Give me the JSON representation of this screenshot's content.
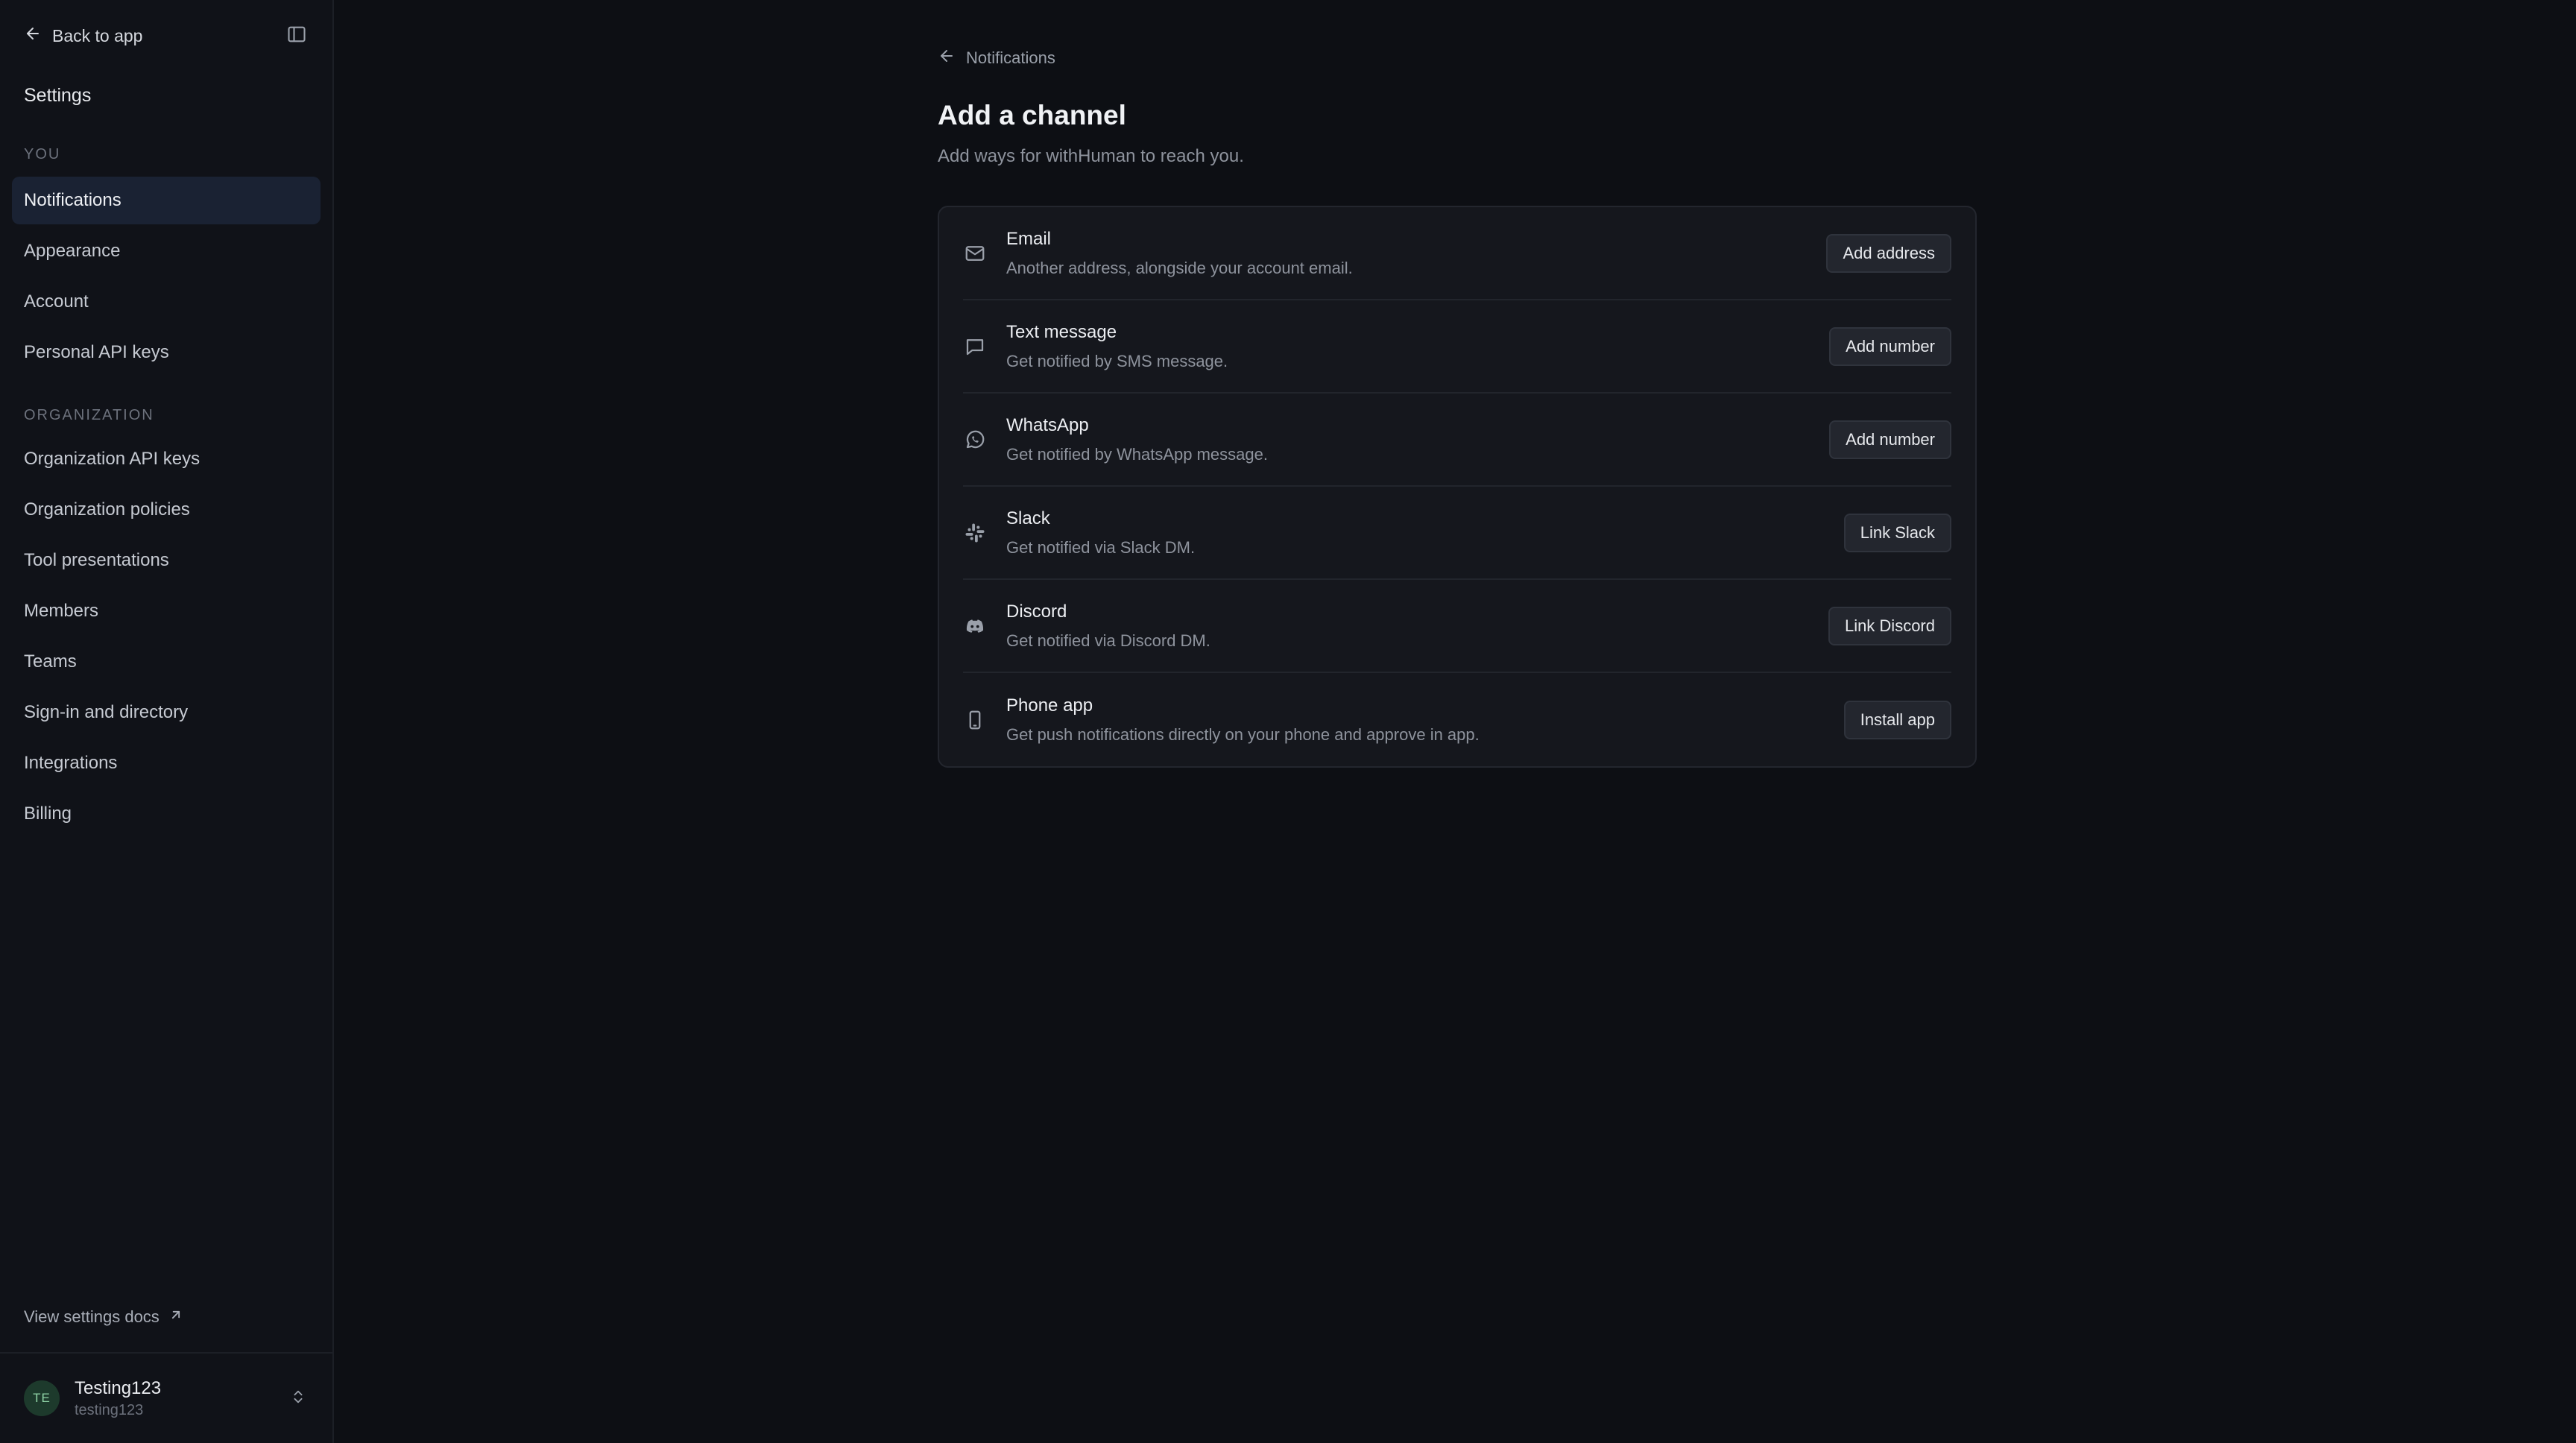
{
  "sidebar": {
    "back_label": "Back to app",
    "title": "Settings",
    "section_you": "YOU",
    "you_items": [
      {
        "label": "Notifications"
      },
      {
        "label": "Appearance"
      },
      {
        "label": "Account"
      },
      {
        "label": "Personal API keys"
      }
    ],
    "section_org": "ORGANIZATION",
    "org_items": [
      {
        "label": "Organization API keys"
      },
      {
        "label": "Organization policies"
      },
      {
        "label": "Tool presentations"
      },
      {
        "label": "Members"
      },
      {
        "label": "Teams"
      },
      {
        "label": "Sign-in and directory"
      },
      {
        "label": "Integrations"
      },
      {
        "label": "Billing"
      }
    ],
    "docs_label": "View settings docs",
    "user": {
      "initials": "TE",
      "name": "Testing123",
      "handle": "testing123"
    }
  },
  "main": {
    "breadcrumb": "Notifications",
    "title": "Add a channel",
    "subtitle": "Add ways for withHuman to reach you.",
    "channels": [
      {
        "icon": "mail-icon",
        "name": "Email",
        "description": "Another address, alongside your account email.",
        "button": "Add address"
      },
      {
        "icon": "message-icon",
        "name": "Text message",
        "description": "Get notified by SMS message.",
        "button": "Add number"
      },
      {
        "icon": "whatsapp-icon",
        "name": "WhatsApp",
        "description": "Get notified by WhatsApp message.",
        "button": "Add number"
      },
      {
        "icon": "slack-icon",
        "name": "Slack",
        "description": "Get notified via Slack DM.",
        "button": "Link Slack"
      },
      {
        "icon": "discord-icon",
        "name": "Discord",
        "description": "Get notified via Discord DM.",
        "button": "Link Discord"
      },
      {
        "icon": "phone-icon",
        "name": "Phone app",
        "description": "Get push notifications directly on your phone and approve in app.",
        "button": "Install app"
      }
    ]
  },
  "colors": {
    "background": "#0d0f14",
    "sidebar": "#101218",
    "active_item": "#1a2233",
    "card": "#15171d",
    "button": "#23262e",
    "avatar_bg": "#1d3a2c",
    "avatar_text": "#8fd3a6"
  }
}
